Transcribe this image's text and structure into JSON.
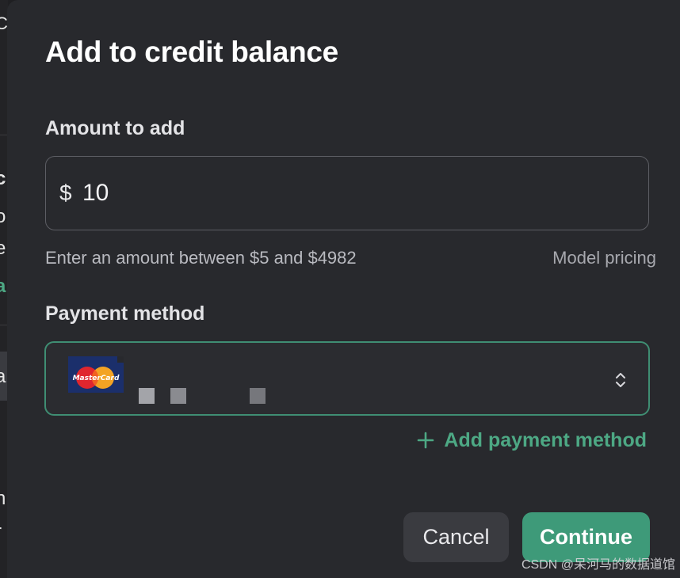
{
  "background": {
    "fragments": [
      "C",
      "c",
      "o",
      "e",
      "a",
      "a",
      "n",
      "r"
    ]
  },
  "dialog": {
    "title": "Add to credit balance",
    "amount": {
      "label": "Amount to add",
      "currency_symbol": "$",
      "value": "10",
      "hint": "Enter an amount between $5 and $4982",
      "pricing_link": "Model pricing"
    },
    "payment": {
      "label": "Payment method",
      "card_brand": "MasterCard",
      "selector_icon": "chevron-up-down-icon",
      "add_label": "Add payment method",
      "add_icon": "plus-icon"
    },
    "buttons": {
      "cancel": "Cancel",
      "continue": "Continue"
    }
  },
  "watermark": "CSDN @呆河马的数据道馆",
  "colors": {
    "accent": "#3e9a79",
    "link_accent": "#4da884",
    "modal_bg": "#28292d",
    "select_border": "#3f8e73"
  }
}
